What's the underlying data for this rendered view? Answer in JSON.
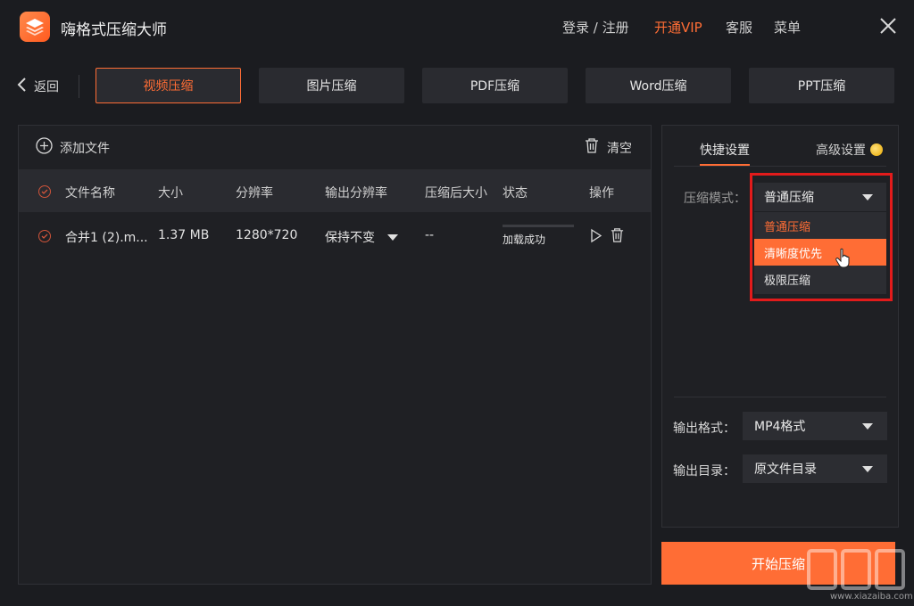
{
  "app": {
    "title": "嗨格式压缩大师"
  },
  "topnav": {
    "login": "登录 / 注册",
    "vip": "开通VIP",
    "service": "客服",
    "menu": "菜单"
  },
  "tabs": {
    "back": "返回",
    "items": [
      "视频压缩",
      "图片压缩",
      "PDF压缩",
      "Word压缩",
      "PPT压缩"
    ],
    "active": "视频压缩"
  },
  "filelist": {
    "add_file": "添加文件",
    "clear": "清空",
    "columns": [
      "文件名称",
      "大小",
      "分辨率",
      "输出分辨率",
      "压缩后大小",
      "状态",
      "操作"
    ],
    "rows": [
      {
        "name": "合并1 (2).m...",
        "size": "1.37 MB",
        "resolution": "1280*720",
        "output_resolution": "保持不变",
        "compressed_size": "--",
        "status": "加载成功"
      }
    ]
  },
  "settings": {
    "tab_quick": "快捷设置",
    "tab_advanced": "高级设置",
    "mode_label": "压缩模式：",
    "mode_value": "普通压缩",
    "mode_options": [
      "普通压缩",
      "清晰度优先",
      "极限压缩"
    ],
    "mode_selected_index": 0,
    "mode_hover_index": 1,
    "format_label": "输出格式：",
    "format_value": "MP4格式",
    "dir_label": "输出目录：",
    "dir_value": "原文件目录",
    "start": "开始压缩"
  },
  "watermark": {
    "url": "www.xiazaiba.com"
  },
  "colors": {
    "accent": "#ff6d35",
    "highlight_box": "#e21b1b",
    "background": "#1b1c20"
  }
}
